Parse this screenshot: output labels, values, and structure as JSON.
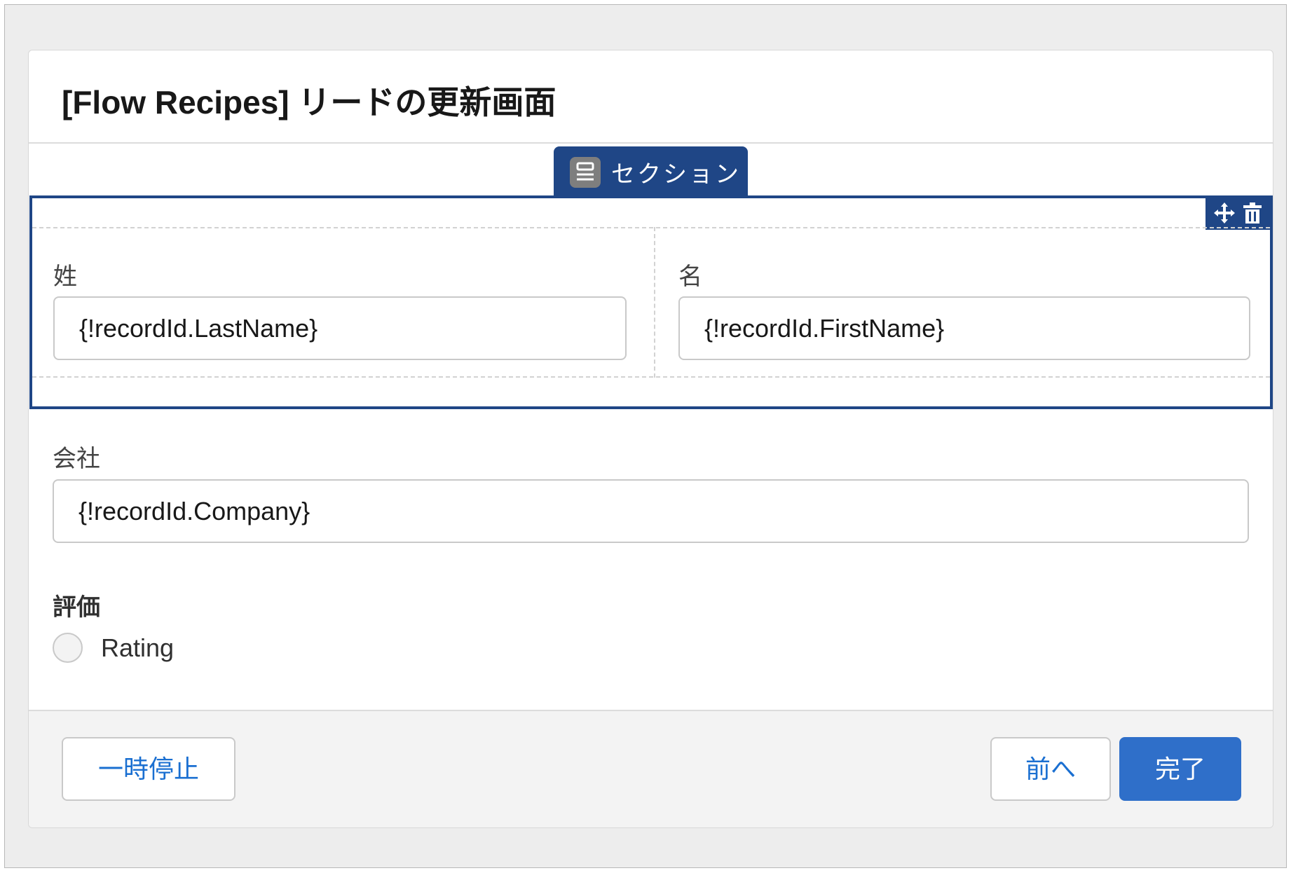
{
  "screen": {
    "title": "[Flow Recipes] リードの更新画面"
  },
  "section": {
    "tab_label": "セクション",
    "tab_icon": "section-layout-icon",
    "tools": [
      "move-icon",
      "trash-icon"
    ],
    "fields": [
      {
        "label": "姓",
        "value": "{!recordId.LastName}"
      },
      {
        "label": "名",
        "value": "{!recordId.FirstName}"
      }
    ]
  },
  "company": {
    "label": "会社",
    "value": "{!recordId.Company}"
  },
  "rating": {
    "label": "評価",
    "option_label": "Rating"
  },
  "footer": {
    "pause_label": "一時停止",
    "previous_label": "前へ",
    "finish_label": "完了"
  },
  "colors": {
    "section_accent": "#1f4686",
    "brand_button": "#2f6fc9",
    "link_text": "#1a6fd1",
    "footer_bg": "#f3f3f3"
  }
}
